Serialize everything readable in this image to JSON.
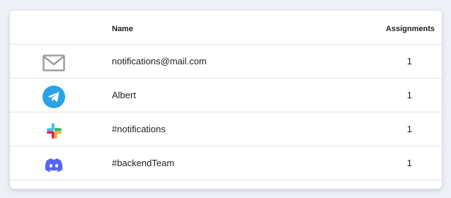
{
  "table": {
    "columns": {
      "icon": "",
      "name": "Name",
      "assignments": "Assignments"
    },
    "rows": [
      {
        "icon": "mail-icon",
        "name": "notifications@mail.com",
        "assignments": "1"
      },
      {
        "icon": "telegram-icon",
        "name": "Albert",
        "assignments": "1"
      },
      {
        "icon": "slack-icon",
        "name": "#notifications",
        "assignments": "1"
      },
      {
        "icon": "discord-icon",
        "name": "#backendTeam",
        "assignments": "1"
      }
    ]
  },
  "colors": {
    "background": "#edf1f5",
    "card": "#ffffff",
    "divider": "#e4e4e4",
    "mail": "#9e9e9e",
    "telegram": "#2aa3e6",
    "discord": "#5865f2"
  }
}
